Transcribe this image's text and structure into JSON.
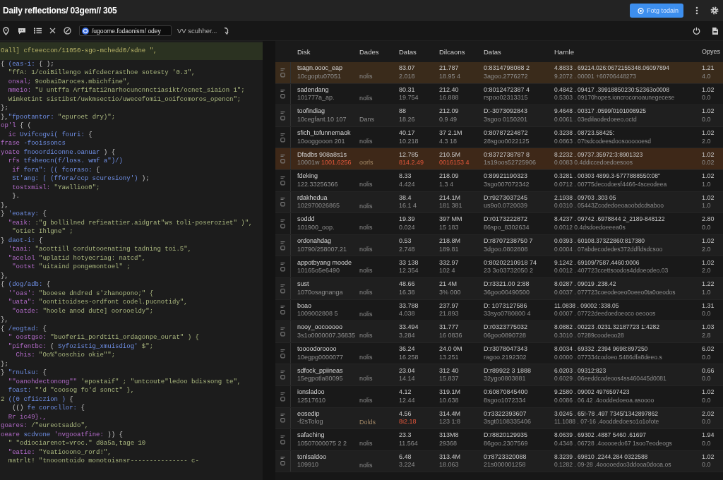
{
  "title_bar": {
    "title": "Daily reflections/ 03gem// 305",
    "button": {
      "label": "Fotg todain"
    }
  },
  "toolbar": {
    "address": {
      "value": "/ugoome.fodaonism/ odey"
    },
    "search_label": "VV scuhher..."
  },
  "code_editor": {
    "lines": [
      {
        "highlighted": true,
        "tokens": [
          {
            "kind": "str",
            "text": "Oall] cfteeccon/11050-sgo-mchedd0/sdne \","
          }
        ]
      },
      {
        "highlighted": false,
        "tokens": [
          {
            "kind": "punct",
            "text": "{ "
          },
          {
            "kind": "key",
            "text": "(eas-i:"
          },
          {
            "kind": "punct",
            "text": " { );"
          }
        ]
      },
      {
        "highlighted": false,
        "tokens": [
          {
            "kind": "str",
            "text": "  \"ffA: 1/coiBillengo wifcdecrasthoe sotesty '0.3\","
          }
        ]
      },
      {
        "highlighted": false,
        "tokens": [
          {
            "kind": "prop",
            "text": "  onsal;"
          },
          {
            "kind": "str",
            "text": " 9oobaiDaroces.mbichfine\","
          }
        ]
      },
      {
        "highlighted": false,
        "tokens": [
          {
            "kind": "prop",
            "text": "  mmeio:"
          },
          {
            "kind": "str",
            "text": " \"U untffa Arfifati2narhocuncnnctiasikt/ocnet_siaion 1\";"
          }
        ]
      },
      {
        "highlighted": false,
        "tokens": [
          {
            "kind": "str",
            "text": "  Wimketint sistibst/uwkmsectio/uwecefomi1_ooifcomoros_opencn\";"
          }
        ]
      },
      {
        "highlighted": false,
        "tokens": [
          {
            "kind": "punct",
            "text": "};"
          }
        ]
      },
      {
        "highlighted": false,
        "tokens": [
          {
            "kind": "punct",
            "text": "},"
          },
          {
            "kind": "key",
            "text": "\"fpootantor:"
          },
          {
            "kind": "str",
            "text": " \"epuroet dry)\";"
          }
        ]
      },
      {
        "highlighted": false,
        "tokens": [
          {
            "kind": "prop",
            "text": "op'l"
          },
          {
            "kind": "punct",
            "text": " { ("
          }
        ]
      },
      {
        "highlighted": false,
        "tokens": [
          {
            "kind": "prop",
            "text": "  ic "
          },
          {
            "kind": "key",
            "text": "Uvifcogvi( fouri:"
          },
          {
            "kind": "punct",
            "text": " {"
          }
        ]
      },
      {
        "highlighted": false,
        "tokens": [
          {
            "kind": "prop",
            "text": "frase"
          },
          {
            "kind": "key",
            "text": " -fooissoncs"
          }
        ]
      },
      {
        "highlighted": false,
        "tokens": [
          {
            "kind": "prop",
            "text": "yoate"
          },
          {
            "kind": "key",
            "text": " fnooordiconne.oanuar"
          },
          {
            "kind": "punct",
            "text": " ) {"
          }
        ]
      },
      {
        "highlighted": false,
        "tokens": [
          {
            "kind": "prop",
            "text": "  rfs"
          },
          {
            "kind": "key",
            "text": " tfsheocn(f/loss. wmf a\")/)"
          }
        ]
      },
      {
        "highlighted": false,
        "tokens": [
          {
            "kind": "prop",
            "text": "   if"
          },
          {
            "kind": "key",
            "text": " fora\": (( fcoraso:"
          },
          {
            "kind": "punct",
            "text": " {"
          }
        ]
      },
      {
        "highlighted": false,
        "tokens": [
          {
            "kind": "key",
            "text": "   St'ang: ( (ffora/ccp scuresiony')"
          },
          {
            "kind": "punct",
            "text": " );"
          }
        ]
      },
      {
        "highlighted": false,
        "tokens": [
          {
            "kind": "prop",
            "text": "   tostxmisl:"
          },
          {
            "kind": "str",
            "text": " \"Yawllioo0\";"
          }
        ]
      },
      {
        "highlighted": false,
        "tokens": [
          {
            "kind": "punct",
            "text": "   }."
          }
        ]
      },
      {
        "highlighted": false,
        "tokens": [
          {
            "kind": "punct",
            "text": "},"
          }
        ]
      },
      {
        "highlighted": false,
        "tokens": [
          {
            "kind": "punct",
            "text": "} "
          },
          {
            "kind": "key",
            "text": "'eoatay:"
          },
          {
            "kind": "punct",
            "text": " {"
          }
        ]
      },
      {
        "highlighted": false,
        "tokens": [
          {
            "kind": "prop",
            "text": "  \"eaik:"
          },
          {
            "kind": "str",
            "text": " :\"g bollilned refieattier.aidgrat\"ws toli-poseroziet\" )\","
          }
        ]
      },
      {
        "highlighted": false,
        "tokens": [
          {
            "kind": "str",
            "text": "   \"otiet Ihlgne\" ;"
          }
        ]
      },
      {
        "highlighted": false,
        "tokens": [
          {
            "kind": "punct",
            "text": "} "
          },
          {
            "kind": "key",
            "text": "daot-i:"
          },
          {
            "kind": "punct",
            "text": " {"
          }
        ]
      },
      {
        "highlighted": false,
        "tokens": [
          {
            "kind": "prop",
            "text": "  'taai:"
          },
          {
            "kind": "str",
            "text": " \"acottill cordutooenating tadning toi.5\","
          }
        ]
      },
      {
        "highlighted": false,
        "tokens": [
          {
            "kind": "prop",
            "text": "  \"acelol"
          },
          {
            "kind": "str",
            "text": " \"uplatid hotyecriag: natcd\","
          }
        ]
      },
      {
        "highlighted": false,
        "tokens": [
          {
            "kind": "prop",
            "text": "   \"ootst"
          },
          {
            "kind": "str",
            "text": " \"uitaind pongemontoel\" ;"
          }
        ]
      },
      {
        "highlighted": false,
        "tokens": [
          {
            "kind": "punct",
            "text": "},"
          }
        ]
      },
      {
        "highlighted": false,
        "tokens": [
          {
            "kind": "punct",
            "text": "{ "
          },
          {
            "kind": "key",
            "text": "(dog/adb:"
          },
          {
            "kind": "punct",
            "text": " {"
          }
        ]
      },
      {
        "highlighted": false,
        "tokens": [
          {
            "kind": "prop",
            "text": "  ''oas':"
          },
          {
            "kind": "str",
            "text": " \"booese dndred s'zhanopono;\" {"
          }
        ]
      },
      {
        "highlighted": false,
        "tokens": [
          {
            "kind": "prop",
            "text": "  \"uata\":"
          },
          {
            "kind": "str",
            "text": " \"oontitoidses-ordfont codel.pucnotidy\","
          }
        ]
      },
      {
        "highlighted": false,
        "tokens": [
          {
            "kind": "prop",
            "text": "   \"oatde:"
          },
          {
            "kind": "str",
            "text": " \"hoole anod dute] oorooeldy\";"
          }
        ]
      },
      {
        "highlighted": false,
        "tokens": [
          {
            "kind": "punct",
            "text": "},"
          }
        ]
      },
      {
        "highlighted": false,
        "tokens": [
          {
            "kind": "punct",
            "text": "{ "
          },
          {
            "kind": "key",
            "text": "/eogtad:"
          },
          {
            "kind": "punct",
            "text": " {"
          }
        ]
      },
      {
        "highlighted": false,
        "tokens": [
          {
            "kind": "prop",
            "text": "  \" oostgso:"
          },
          {
            "kind": "str",
            "text": " \"buoferi1_pordtiti_ordagonpe_ourat\" ) {"
          }
        ]
      },
      {
        "highlighted": false,
        "tokens": [
          {
            "kind": "prop",
            "text": "  \"pifentbc:"
          },
          {
            "kind": "punct",
            "text": " ( "
          },
          {
            "kind": "key",
            "text": "Syfozistig_xmuisdiog'"
          },
          {
            "kind": "str",
            "text": " $\";"
          }
        ]
      },
      {
        "highlighted": false,
        "tokens": [
          {
            "kind": "prop",
            "text": "    Chis:"
          },
          {
            "kind": "str",
            "text": " \"Oo%\"ooschio okie\"\";"
          }
        ]
      },
      {
        "highlighted": false,
        "tokens": [
          {
            "kind": "punct",
            "text": "};"
          }
        ]
      },
      {
        "highlighted": false,
        "tokens": [
          {
            "kind": "punct",
            "text": "} "
          },
          {
            "kind": "key",
            "text": "\"rnulsu:"
          },
          {
            "kind": "punct",
            "text": " {"
          }
        ]
      },
      {
        "highlighted": false,
        "tokens": [
          {
            "kind": "prop",
            "text": "  \"\"oanohdectonong\"\""
          },
          {
            "kind": "str",
            "text": " 'epostaif\" ; \"untcoute\"ledoo bdissong te\","
          }
        ]
      },
      {
        "highlighted": false,
        "tokens": [
          {
            "kind": "key",
            "text": "  foast:"
          },
          {
            "kind": "str",
            "text": " \"'d \"coosog fo'd sonct\" },"
          }
        ]
      },
      {
        "highlighted": false,
        "tokens": [
          {
            "kind": "str",
            "text": "2 "
          },
          {
            "kind": "key",
            "text": "((0 cfiiczion )"
          },
          {
            "kind": "punct",
            "text": " {"
          }
        ]
      },
      {
        "highlighted": false,
        "tokens": [
          {
            "kind": "punct",
            "text": "   (() "
          },
          {
            "kind": "key",
            "text": "fe corocllor:"
          },
          {
            "kind": "punct",
            "text": " {"
          }
        ]
      },
      {
        "highlighted": false,
        "tokens": [
          {
            "kind": "prop",
            "text": "  Rr ic49}.,"
          }
        ]
      },
      {
        "highlighted": false,
        "tokens": [
          {
            "kind": "prop",
            "text": "goares:"
          },
          {
            "kind": "str",
            "text": " /\"eureotsaddo\","
          }
        ]
      },
      {
        "highlighted": false,
        "tokens": [
          {
            "kind": "prop",
            "text": "oeare"
          },
          {
            "kind": "key",
            "text": " scdvone"
          },
          {
            "kind": "prop",
            "text": " 'nvgooatfine:"
          },
          {
            "kind": "punct",
            "text": " )) {"
          }
        ]
      },
      {
        "highlighted": false,
        "tokens": [
          {
            "kind": "str",
            "text": "  \" \"odiociarenot=vroc.\" d8a5a,tage 10"
          }
        ]
      },
      {
        "highlighted": false,
        "tokens": [
          {
            "kind": "prop",
            "text": "  \"eatie:"
          },
          {
            "kind": "str",
            "text": " \"Yeatiooono_rord!\","
          }
        ]
      },
      {
        "highlighted": false,
        "tokens": [
          {
            "kind": "str",
            "text": "  matrlt! \"tnooontoido monotoisnsr--------------- c-"
          }
        ]
      }
    ]
  },
  "table": {
    "columns": [
      "Disk",
      "Dades",
      "Datas",
      "Dilcaons",
      "Datas",
      "Harnle",
      "Opyes"
    ],
    "rows": [
      {
        "selected": true,
        "flagged": false,
        "cells": [
          [
            "tsagn.oooc_eap",
            "10cgoptu07051"
          ],
          [
            "nolis"
          ],
          [
            "83.07",
            "2.018"
          ],
          [
            "21.787",
            "18.95 4"
          ],
          [
            "0:8314798088 2",
            "3agoo.2776272"
          ],
          [
            "4.8833 . 69214.026:0672155348.06097894",
            "9.2072 . 00001 +60706448273"
          ],
          [
            "1.21",
            "4.0"
          ]
        ]
      },
      {
        "selected": false,
        "flagged": false,
        "cells": [
          [
            "sadendang",
            "101777a_ap."
          ],
          [
            "nolis"
          ],
          [
            "80.31",
            "19.754"
          ],
          [
            "212.40",
            "16.888"
          ],
          [
            "0:8012472387 4",
            "rspoo02313315"
          ],
          [
            "0.4842 . 09417 .39918850230:52363o0008",
            "0.5303 . 09170hopes.ioncroconoaunegecese"
          ],
          [
            "1.02",
            "0.0"
          ]
        ]
      },
      {
        "selected": false,
        "flagged": false,
        "cells": [
          [
            "toofindiag",
            "10cegfant.10 107"
          ],
          [
            "Dans"
          ],
          [
            "88",
            "18.26"
          ],
          [
            "212.09",
            "0.9 49"
          ],
          [
            "D:-3073092843",
            "3sgoo 0150201"
          ],
          [
            "9.4648 . 00317 .0599/0101008925",
            "0.0061 . 03edilaodedoeeo.octd"
          ],
          [
            "1.02",
            "0.0"
          ]
        ]
      },
      {
        "selected": false,
        "flagged": false,
        "cells": [
          [
            "sfich_tofunnemaok",
            "10ooggooon 201"
          ],
          [
            "nolis"
          ],
          [
            "40.17",
            "10.218"
          ],
          [
            "37 2.1M",
            "4.3 18"
          ],
          [
            "0:80787224872",
            "28sgoo0022125"
          ],
          [
            "0.3238 . 08723.58425:",
            "0.0863 . 07tsdcodeesdoosoooooesd"
          ],
          [
            "1.02",
            "2.0"
          ]
        ]
      },
      {
        "selected": false,
        "flagged": true,
        "cells": [
          [
            "Dfadbs 908a8s1s",
            [
              "10001w",
              {
                "text": "1001.6256",
                "kind": "alert"
              }
            ]
          ],
          [
            {
              "text": "oorls",
              "kind": "dim"
            }
          ],
          [
            "12.785",
            {
              "text": "814.2.49",
              "kind": "alert"
            }
          ],
          [
            "210.5M",
            {
              "text": "0016153 4",
              "kind": "alert"
            }
          ],
          [
            "0:8372738787 8",
            "1s19oos52725906"
          ],
          [
            "8.2232 . 09737.35972:3:8901323",
            "0.0083 0.4ddiccedoedoesoos"
          ],
          [
            "1.02",
            "0.02"
          ]
        ]
      },
      {
        "selected": false,
        "flagged": false,
        "cells": [
          [
            "fdeking",
            "122.33256366"
          ],
          [
            "nolis"
          ],
          [
            "8.33",
            "4.424"
          ],
          [
            "218.09",
            "1.3 4"
          ],
          [
            "0:89921190323",
            "3sgo007072342"
          ],
          [
            "0.3281 . 00303 4899.3-5777888550:08\"",
            "0.0712 . 00775decodoesf4466-4sceodeea"
          ],
          [
            "1.02",
            "1.0"
          ]
        ]
      },
      {
        "selected": false,
        "flagged": false,
        "cells": [
          [
            "rdakhedua",
            "102970026865"
          ],
          [
            "nolis"
          ],
          [
            "38.4",
            "16.1 4"
          ],
          [
            "214.1M",
            "181 381"
          ],
          [
            "D:r9273037245",
            "us9o0.0720039"
          ],
          [
            "2.1938 . 09703 .303 05",
            "0.0310 . 05443Zcodedoeoaoobdcdsaboo"
          ],
          [
            "1.02",
            "1.0"
          ]
        ]
      },
      {
        "selected": false,
        "flagged": false,
        "cells": [
          [
            "soddd",
            "101900_oop."
          ],
          [
            "nolis"
          ],
          [
            "19.39",
            "0.024"
          ],
          [
            "397 MM",
            "15 183"
          ],
          [
            "D:r0173222872",
            "86spo_8302634"
          ],
          [
            "8.4237 . 09742 .6978844 2_2189-848122",
            "0.0012 0.4dsdoedoeeea0s"
          ],
          [
            "2.80",
            "0.0"
          ]
        ]
      },
      {
        "selected": false,
        "flagged": false,
        "cells": [
          [
            "ordonahdag",
            "10790/258007.21"
          ],
          [
            "nolis"
          ],
          [
            "0.53",
            "2.748"
          ],
          [
            "218.8M",
            "189.81"
          ],
          [
            "D:r8707238750 7",
            "3dgoo.0802808"
          ],
          [
            "0.0393 . 60108.373Z2860:817380",
            "0.0004 . 07abdecodedes372ddfldsdcsoo"
          ],
          [
            "1.02",
            "2.0"
          ]
        ]
      },
      {
        "selected": false,
        "flagged": false,
        "cells": [
          [
            "appotbyang moode",
            "10165o5e6490"
          ],
          [
            "nolis"
          ],
          [
            "33 138",
            "12.354"
          ],
          [
            "332.97",
            "102 4"
          ],
          [
            "0:80202210918 74",
            "23 3o03732050 2"
          ],
          [
            "9.1242 . 69109/7587.4460:0006",
            "0.0012 . 407723ccettsoodos4ddoeodeo.03"
          ],
          [
            "1.02",
            "2.0"
          ]
        ]
      },
      {
        "selected": false,
        "flagged": false,
        "cells": [
          [
            "sust",
            "1070osagnanga"
          ],
          [
            "nolis"
          ],
          [
            "48.66",
            "16.38"
          ],
          [
            "21 4M",
            "3% 000"
          ],
          [
            "D:r3321.00 2:88",
            "36goo00490500"
          ],
          [
            "8.0287 . 09019 .238.42",
            "0.0037 . 077723coeodeoeo0oeeo0ta0oeodos"
          ],
          [
            "1.22",
            "1.0"
          ]
        ]
      },
      {
        "selected": false,
        "flagged": false,
        "cells": [
          [
            "boao",
            "1009002808 5"
          ],
          [
            "nolis"
          ],
          [
            "33.788",
            "4.038"
          ],
          [
            "237.97",
            "21.893"
          ],
          [
            "D: 1073127586",
            "33syo0780800 4"
          ],
          [
            "11.0838 . 09002 :338.05",
            "0.0007 . 07722deedoedoeoco oeooos"
          ],
          [
            "1.31",
            "0.0"
          ]
        ]
      },
      {
        "selected": false,
        "flagged": false,
        "cells": [
          [
            "nooy_oocooooo",
            "3s1o0000007.36835"
          ],
          [
            "nolis"
          ],
          [
            "33.494",
            "3.284"
          ],
          [
            "31.777",
            "16 0836"
          ],
          [
            "D:r0323775032",
            "06goo0890728"
          ],
          [
            "8.0882 . 00223 .0231.32187723 1:4282",
            "0.3010 . 07289coodeoo28"
          ],
          [
            "1.03",
            "2.8"
          ]
        ]
      },
      {
        "selected": false,
        "flagged": false,
        "cells": [
          [
            "toooodoroooo",
            "10egpg0000077"
          ],
          [
            "nolis"
          ],
          [
            "36.24",
            "16.258"
          ],
          [
            "24.0 0M",
            "13.251"
          ],
          [
            "D:r3078047343",
            "ragoo.2192302"
          ],
          [
            "8.0034 . 69332 .2394 9698:897250",
            "0.0000 . 077334codoeo.5486dfa8deeo.s"
          ],
          [
            "6.02",
            "0.0"
          ]
        ]
      },
      {
        "selected": false,
        "flagged": false,
        "cells": [
          [
            "sdfock_ppiineas",
            "15egpotla80095"
          ],
          [
            "nolis"
          ],
          [
            "23.04",
            "14.14"
          ],
          [
            "312 40",
            "15.837"
          ],
          [
            "D:r89922 3 1888",
            "32ygo0803881"
          ],
          [
            "6.0203 . 09312:823",
            "0.6029 . 06eeddcodeoos4ss460445d0081"
          ],
          [
            "0.66",
            "0.0"
          ]
        ]
      },
      {
        "selected": false,
        "flagged": false,
        "cells": [
          [
            "ionsladoo",
            "12517610"
          ],
          [
            "nolis"
          ],
          [
            "4.12",
            "12.44"
          ],
          [
            "319.1M",
            "10.638"
          ],
          [
            "0:60870845400",
            "8sgoo1072334"
          ],
          [
            "9.2580 . 09002 4976597423",
            "0.0086 . 06.42 .4ooddedoeoa.asoooo"
          ],
          [
            "1.02",
            "0.0"
          ]
        ]
      },
      {
        "selected": false,
        "flagged": false,
        "cells": [
          [
            "eosedip",
            "-f2sTolog"
          ],
          [
            {
              "text": "Dolds",
              "kind": "dim"
            }
          ],
          [
            "4.56",
            {
              "text": "8i2.18",
              "kind": "alert"
            }
          ],
          [
            "314.4M",
            "123 1:8"
          ],
          [
            "0:r3322393607",
            "3sgt0108335406"
          ],
          [
            "3.0245 . 65!-78 .497 7345/1342897862",
            "11.1088 . 07-16 .4ooddedoeso1o1ofote"
          ],
          [
            "2.02",
            "0.0"
          ]
        ]
      },
      {
        "selected": false,
        "flagged": false,
        "cells": [
          [
            "safaching",
            "10507000075 2 2"
          ],
          [
            "nolis"
          ],
          [
            "23.3",
            "11.564"
          ],
          [
            "313M8",
            "29368"
          ],
          [
            "D:r8820129935",
            "86goo.2307569"
          ],
          [
            "8.0639 . 69302 .4887 5460 .61697",
            "0.4348 . 06728 .4ooooedo67 1soo7eodeogs"
          ],
          [
            "1.94",
            "0.0"
          ]
        ]
      },
      {
        "selected": false,
        "flagged": false,
        "cells": [
          [
            "tonlsaldoo",
            "109910"
          ],
          [
            "nolis"
          ],
          [
            "6.48",
            "3.224"
          ],
          [
            "313.4M",
            "18.063"
          ],
          [
            "0:r8723320088",
            "21s000001258"
          ],
          [
            "8.3239 . 69810 .2244.284 0322588",
            "0.1282 . 09-28 .4ooooedoo3ddooa0dooa.os"
          ],
          [
            "1.02",
            "0.0"
          ]
        ]
      }
    ]
  }
}
